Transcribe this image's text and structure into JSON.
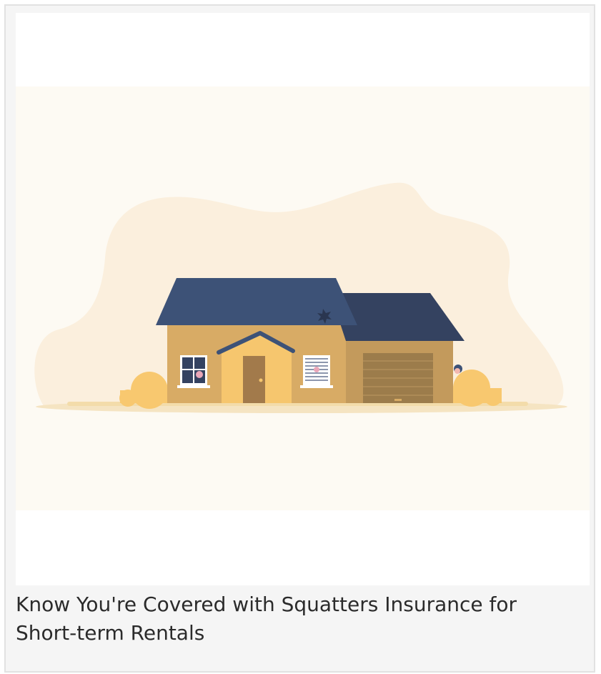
{
  "article_card": {
    "image": {
      "icon": "house-illustration-icon",
      "colors": {
        "background": "#fdfaf3",
        "blob": "#fbefdd",
        "roof_main": "#3d5277",
        "roof_garage": "#344260",
        "wall_main": "#d8ab65",
        "wall_garage": "#c39a5c",
        "entry_gable": "#f6c66e",
        "door": "#a27a4b",
        "garage_door": "#9c7c4b",
        "bush": "#f8c86f",
        "ground": "#f3dcaa"
      }
    },
    "caption": "Know You're Covered with Squatters Insurance for Short-term Rentals"
  }
}
